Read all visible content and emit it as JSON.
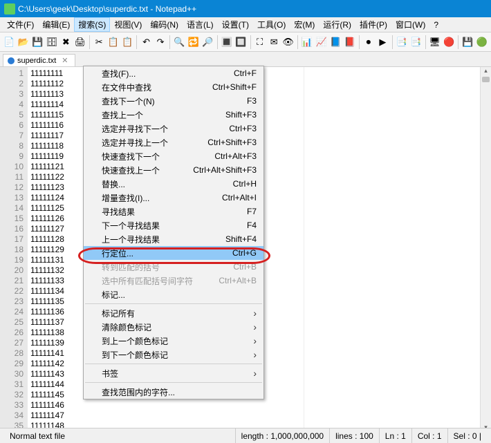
{
  "window": {
    "title": "C:\\Users\\geek\\Desktop\\superdic.txt - Notepad++"
  },
  "menubar": {
    "items": [
      {
        "label": "文件(F)"
      },
      {
        "label": "编辑(E)"
      },
      {
        "label": "搜索(S)",
        "active": true
      },
      {
        "label": "视图(V)"
      },
      {
        "label": "编码(N)"
      },
      {
        "label": "语言(L)"
      },
      {
        "label": "设置(T)"
      },
      {
        "label": "工具(O)"
      },
      {
        "label": "宏(M)"
      },
      {
        "label": "运行(R)"
      },
      {
        "label": "插件(P)"
      },
      {
        "label": "窗口(W)"
      },
      {
        "label": "?"
      }
    ]
  },
  "toolbar": {
    "icons": [
      "📄",
      "📂",
      "💾",
      "🗄",
      "✖",
      "🖨",
      "|",
      "✂",
      "📋",
      "📋",
      "|",
      "↶",
      "↷",
      "|",
      "🔍",
      "🔁",
      "🔎",
      "|",
      "🔳",
      "🔲",
      "|",
      "⛶",
      "✉",
      "👁",
      "|",
      "📊",
      "📈",
      "📘",
      "📕",
      "|",
      "⏺",
      "▶",
      "|",
      "📑",
      "📑",
      "|",
      "🖥",
      "🔴",
      "|",
      "💾",
      "🟢"
    ]
  },
  "tab": {
    "label": "superdic.txt"
  },
  "editor": {
    "lines": [
      "11111111",
      "11111112",
      "11111113",
      "11111114",
      "11111115",
      "11111116",
      "11111117",
      "11111118",
      "11111119",
      "11111121",
      "11111122",
      "11111123",
      "11111124",
      "11111125",
      "11111126",
      "11111127",
      "11111128",
      "11111129",
      "11111131",
      "11111132",
      "11111133",
      "11111134",
      "11111135",
      "11111136",
      "11111137",
      "11111138",
      "11111139",
      "11111141",
      "11111142",
      "11111143",
      "11111144",
      "11111145",
      "11111146",
      "11111147",
      "11111148"
    ]
  },
  "dropdown": {
    "items": [
      {
        "label": "查找(F)...",
        "shortcut": "Ctrl+F"
      },
      {
        "label": "在文件中查找",
        "shortcut": "Ctrl+Shift+F"
      },
      {
        "label": "查找下一个(N)",
        "shortcut": "F3"
      },
      {
        "label": "查找上一个",
        "shortcut": "Shift+F3"
      },
      {
        "label": "选定并寻找下一个",
        "shortcut": "Ctrl+F3"
      },
      {
        "label": "选定并寻找上一个",
        "shortcut": "Ctrl+Shift+F3"
      },
      {
        "label": "快速查找下一个",
        "shortcut": "Ctrl+Alt+F3"
      },
      {
        "label": "快速查找上一个",
        "shortcut": "Ctrl+Alt+Shift+F3"
      },
      {
        "label": "替换...",
        "shortcut": "Ctrl+H"
      },
      {
        "label": "增量查找(I)...",
        "shortcut": "Ctrl+Alt+I"
      },
      {
        "label": "寻找结果",
        "shortcut": "F7"
      },
      {
        "label": "下一个寻找结果",
        "shortcut": "F4"
      },
      {
        "label": "上一个寻找结果",
        "shortcut": "Shift+F4"
      },
      {
        "label": "行定位...",
        "shortcut": "Ctrl+G",
        "highlighted": true
      },
      {
        "label": "转到匹配的括号",
        "shortcut": "Ctrl+B",
        "disabled": true
      },
      {
        "label": "选中所有匹配括号间字符",
        "shortcut": "Ctrl+Alt+B",
        "disabled": true
      },
      {
        "label": "标记..."
      },
      {
        "sep": true
      },
      {
        "label": "标记所有",
        "submenu": true
      },
      {
        "label": "清除颜色标记",
        "submenu": true
      },
      {
        "label": "到上一个颜色标记",
        "submenu": true
      },
      {
        "label": "到下一个颜色标记",
        "submenu": true
      },
      {
        "sep": true
      },
      {
        "label": "书签",
        "submenu": true
      },
      {
        "sep": true
      },
      {
        "label": "查找范围内的字符..."
      }
    ]
  },
  "statusbar": {
    "type": "Normal text file",
    "length": "length : 1,000,000,000",
    "lines": "lines : 100",
    "ln": "Ln : 1",
    "col": "Col : 1",
    "sel": "Sel : 0 |"
  }
}
